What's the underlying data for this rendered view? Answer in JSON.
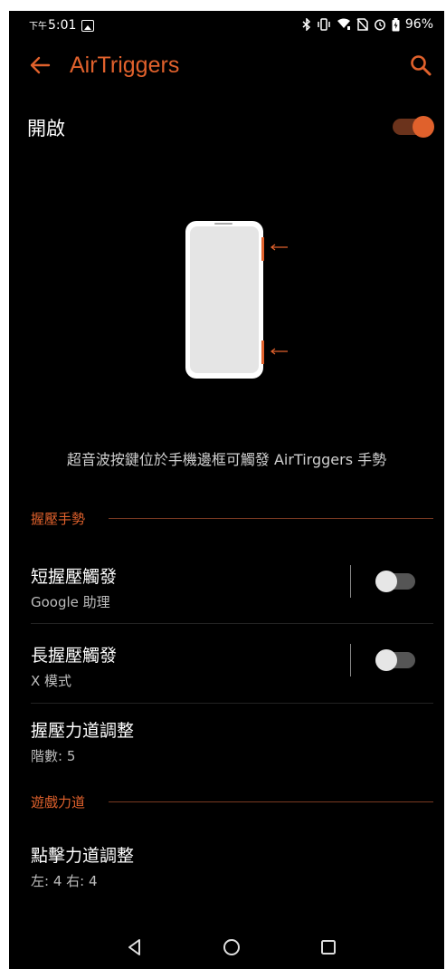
{
  "status": {
    "ampm": "下午",
    "time": "5:01",
    "battery": "96%"
  },
  "appbar": {
    "title": "AirTriggers"
  },
  "main_switch": {
    "label": "開啟",
    "on": true
  },
  "description": "超音波按鍵位於手機邊框可觸發 AirTirggers 手勢",
  "sections": {
    "grip": {
      "title": "握壓手勢",
      "items": [
        {
          "primary": "短握壓觸發",
          "secondary": "Google 助理",
          "toggle_on": false
        },
        {
          "primary": "長握壓觸發",
          "secondary": "X 模式",
          "toggle_on": false
        },
        {
          "primary": "握壓力道調整",
          "secondary": "階數: 5"
        }
      ]
    },
    "game": {
      "title": "遊戲力道",
      "items": [
        {
          "primary": "點擊力道調整",
          "secondary": "左: 4 右: 4"
        }
      ]
    }
  },
  "colors": {
    "accent": "#e0612c",
    "background": "#000000"
  },
  "icons": {
    "back": "arrow-left-icon",
    "search": "search-icon",
    "nav": [
      "back-triangle-icon",
      "home-circle-icon",
      "recents-square-icon"
    ]
  }
}
